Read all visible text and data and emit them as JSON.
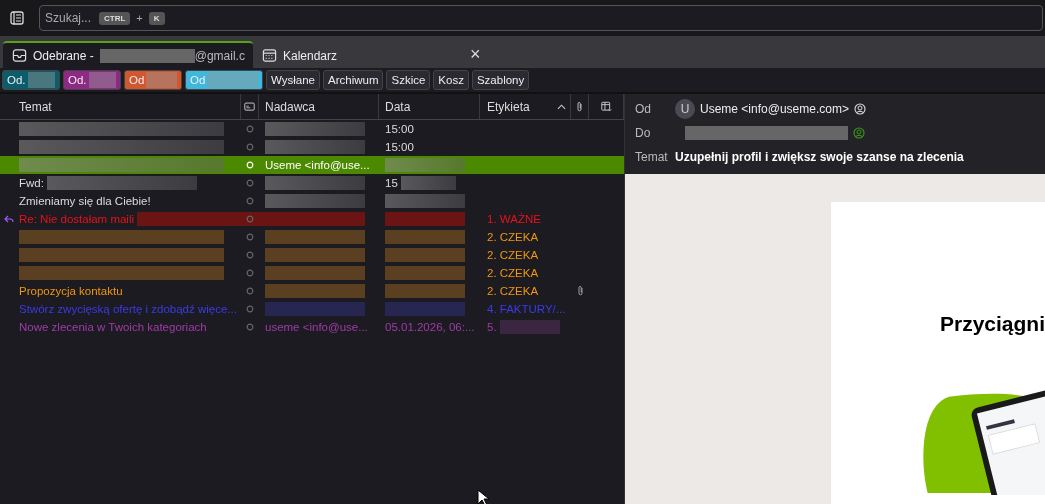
{
  "search": {
    "placeholder": "Szukaj...",
    "shortcut_keys": [
      "CTRL",
      "K"
    ],
    "shortcut_joiner": "+"
  },
  "tabs": [
    {
      "label": "Odebrane - ",
      "label_end": "@gmail.c",
      "redacted": true,
      "kind": "mail",
      "selected": true
    },
    {
      "label": "Kalendarz",
      "kind": "calendar",
      "selected": false
    }
  ],
  "tab_close": "×",
  "folders": [
    {
      "label": "Od.",
      "color": "#0b5d6b",
      "redacted": true
    },
    {
      "label": "Od.",
      "color": "#8e2a86",
      "redacted": true
    },
    {
      "label": "Od",
      "color": "#d2572f",
      "redacted": true
    },
    {
      "label": "Od",
      "color": "#3fb8dc",
      "redacted": true
    },
    {
      "label": "Wysłane"
    },
    {
      "label": "Archiwum"
    },
    {
      "label": "Szkice"
    },
    {
      "label": "Kosz"
    },
    {
      "label": "Szablony"
    }
  ],
  "columns": {
    "subject": "Temat",
    "sender": "Nadawca",
    "date": "Data",
    "tag": "Etykieta"
  },
  "rows": [
    {
      "subject_redacted": true,
      "sender_redacted": true,
      "date": "15:00",
      "selected": false
    },
    {
      "subject_redacted": true,
      "sender_redacted": true,
      "date": "15:00",
      "selected": false
    },
    {
      "subject_redacted": true,
      "sender": "Useme <info@use...",
      "date_redacted": true,
      "selected": true
    },
    {
      "subject": "Fwd:",
      "subject_redacted": true,
      "sender_redacted": true,
      "date": "15",
      "date_redacted": true,
      "selected": false
    },
    {
      "subject": "Zmieniamy się dla Ciebie!",
      "sender_redacted": true,
      "date_redacted": true,
      "selected": false
    },
    {
      "subject": "Re: Nie dostałam maili",
      "subject_redacted": true,
      "sender_redacted": true,
      "date_redacted": true,
      "tag": "1. WAŻNE",
      "color": "#e8101a",
      "selected": false,
      "replied": true
    },
    {
      "subject_redacted": true,
      "sender_redacted": true,
      "date_redacted": true,
      "tag": "2. CZEKA",
      "color": "#f0960f",
      "selected": false
    },
    {
      "subject_redacted": true,
      "sender_redacted": true,
      "date_redacted": true,
      "tag": "2. CZEKA",
      "color": "#f0960f",
      "selected": false
    },
    {
      "subject_redacted": true,
      "sender_redacted": true,
      "date_redacted": true,
      "tag": "2. CZEKA",
      "color": "#f0960f",
      "selected": false
    },
    {
      "subject": "Propozycja kontaktu",
      "sender_redacted": true,
      "date_redacted": true,
      "tag": "2. CZEKA",
      "color": "#f0960f",
      "selected": false,
      "attachment": true
    },
    {
      "subject": "Stwórz zwycięską ofertę i zdobądź więce...",
      "sender_redacted": true,
      "date_redacted": true,
      "tag": "4. FAKTURY/...",
      "color": "#3a3ae8",
      "selected": false
    },
    {
      "subject": "Nowe zlecenia w Twoich kategoriach",
      "sender": "useme <info@use...",
      "date": "05.01.2026, 06:...",
      "tag": "5.",
      "tag_redacted": true,
      "color": "#a03aa8",
      "selected": false
    }
  ],
  "header": {
    "from_label": "Od",
    "avatar": "U",
    "from": "Useme <info@useme.com>",
    "to_label": "Do",
    "to_redacted": true,
    "subject_label": "Temat",
    "subject": "Uzupełnij profil i zwiększ swoje szanse na zlecenia"
  },
  "body": {
    "heading": "Przyciągni"
  }
}
